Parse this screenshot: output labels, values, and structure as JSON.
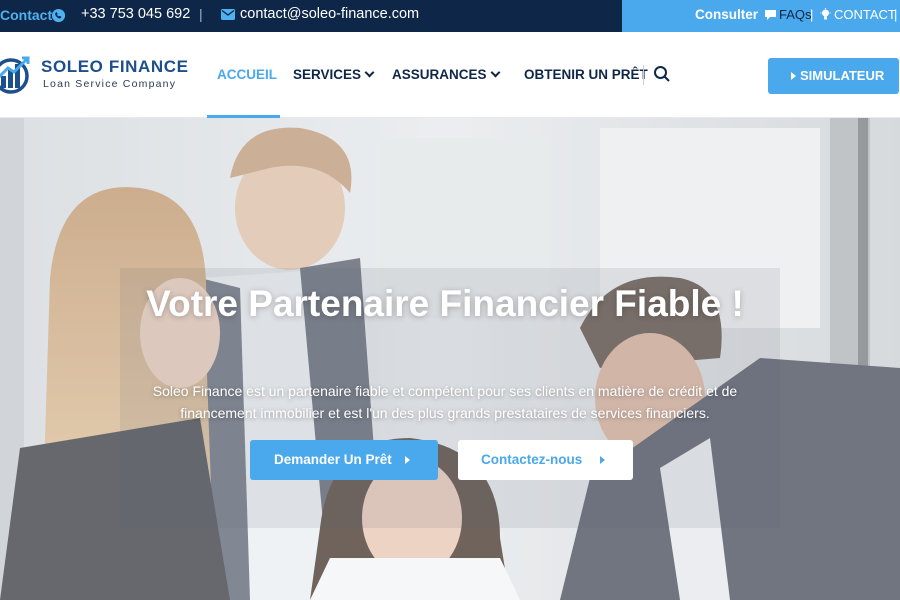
{
  "topbar": {
    "contact_label": "Contact:",
    "phone": "+33 753 045 692",
    "separator": "|",
    "email": "contact@soleo-finance.com",
    "consult_label": "Consulter",
    "faq_label": "FAQs",
    "divider": "|",
    "contact_link": "CONTACT",
    "icons": [
      "whatsapp-icon",
      "mail-icon",
      "chat-bubble-icon",
      "lightbulb-icon"
    ]
  },
  "header": {
    "logo_name": "SOLEO FINANCE",
    "logo_tagline": "Loan Service Company",
    "nav": [
      {
        "label": "ACCUEIL",
        "active": true
      },
      {
        "label": "SERVICES",
        "dropdown": true
      },
      {
        "label": "ASSURANCES",
        "dropdown": true
      },
      {
        "label": "OBTENIR UN PRÊT"
      }
    ],
    "simulator_label": "SIMULATEUR"
  },
  "hero": {
    "title": "Votre Partenaire Financier Fiable !",
    "text": "Soleo Finance est un partenaire fiable et compétent pour ses clients en matière de crédit et de financement immobilier et est l'un des plus grands prestataires de services financiers.",
    "primary_button": "Demander Un Prêt",
    "secondary_button": "Contactez-nous"
  },
  "colors": {
    "navy": "#0e2748",
    "accent": "#4aa8ec",
    "logo_blue": "#1c4f8c"
  }
}
